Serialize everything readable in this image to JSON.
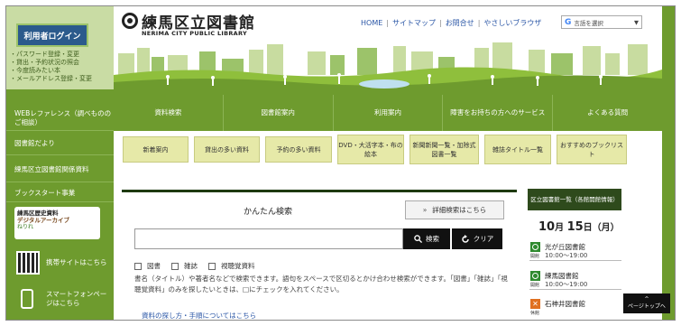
{
  "login": {
    "button": "利用者ログイン",
    "links": [
      "・パスワード登録・変更",
      "・貸出・予約状況の照会",
      "・今度読みたい本",
      "・メールアドレス登録・変更"
    ]
  },
  "sidebar": {
    "items": [
      {
        "label": "WEBレファレンス（調べもののご相談）"
      },
      {
        "label": "図書館だより"
      },
      {
        "label": "練馬区立図書館関係資料"
      },
      {
        "label": "ブックスタート事業"
      }
    ],
    "banner": {
      "line1": "練馬区歴史資料",
      "line2": "デジタルアーカイブ",
      "line3": "ねりれ"
    },
    "mobile": "携帯サイトはこちら",
    "smartphone": "スマートフォンページはこちら"
  },
  "header": {
    "title": "練馬区立図書館",
    "subtitle": "NERIMA CITY PUBLIC LIBRARY",
    "links": [
      "HOME",
      "サイトマップ",
      "お問合せ",
      "やさしいブラウザ"
    ],
    "translate": "言語を選択"
  },
  "nav": [
    "資料検索",
    "図書館案内",
    "利用案内",
    "障害をお持ちの方へのサービス",
    "よくある質問"
  ],
  "quick": [
    "新着案内",
    "貸出の多い資料",
    "予約の多い資料",
    "DVD・大活字本・布の絵本",
    "新聞新聞一覧・加除式図書一覧",
    "雑誌タイトル一覧",
    "おすすめのブックリスト"
  ],
  "search": {
    "title": "かんたん検索",
    "advanced": "詳細検索はこちら",
    "search_button": "検索",
    "clear_button": "クリア",
    "checks": [
      "図書",
      "雑誌",
      "視聴覚資料"
    ],
    "description": "書名（タイトル）や著者名などで検索できます。語句をスペースで区切るとかけ合わせ検索ができます。「図書」「雑誌」「視聴覚資料」のみを探したいときは、□にチェックを入れてください。",
    "link_cut": "資料の探し方・手順についてはこちら"
  },
  "calendar": {
    "title": "区立図書館一覧（各館開館情報）",
    "month": "10",
    "day": "15",
    "weekday": "月",
    "entries": [
      {
        "name": "光が丘図書館",
        "hours": "10:00～19:00",
        "status": "open",
        "label": "開館"
      },
      {
        "name": "練馬図書館",
        "hours": "10:00～19:00",
        "status": "open",
        "label": "開館"
      },
      {
        "name": "石神井図書館",
        "hours": "",
        "status": "closed",
        "label": "休館"
      }
    ]
  },
  "pagetop": {
    "arrow": "^",
    "label": "ページトップへ"
  },
  "colors": {
    "green": "#6e9b2e",
    "navy": "#2b5a8c",
    "quick_bg": "#e6e9a8",
    "dark": "#111111"
  }
}
